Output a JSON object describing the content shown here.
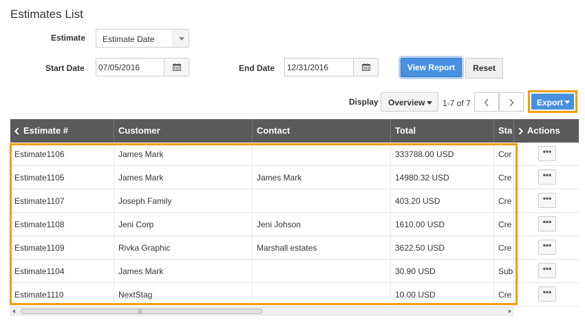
{
  "page": {
    "title": "Estimates List"
  },
  "filters": {
    "estimate_label": "Estimate",
    "estimate_value": "Estimate Date",
    "start_date_label": "Start Date",
    "start_date_value": "07/05/2016",
    "end_date_label": "End Date",
    "end_date_value": "12/31/2016",
    "view_report_label": "View Report",
    "reset_label": "Reset"
  },
  "toolbar": {
    "display_label": "Display",
    "display_value": "Overview",
    "pager_text": "1-7 of 7",
    "export_label": "Export"
  },
  "table": {
    "headers": {
      "estimate": "Estimate #",
      "customer": "Customer",
      "contact": "Contact",
      "total": "Total",
      "status": "Sta",
      "actions": "Actions"
    },
    "rows": [
      {
        "estimate": "Estimate1106",
        "customer": "James Mark",
        "contact": "",
        "total": "333788.00  USD",
        "status": "Cor",
        "action": "•••"
      },
      {
        "estimate": "Estimate1105",
        "customer": "James Mark",
        "contact": "James Mark",
        "total": "14980.32  USD",
        "status": "Cre",
        "action": "•••"
      },
      {
        "estimate": "Estimate1107",
        "customer": "Joseph Family",
        "contact": "",
        "total": "403.20  USD",
        "status": "Cre",
        "action": "•••"
      },
      {
        "estimate": "Estimate1108",
        "customer": "Jeni Corp",
        "contact": "Jeni Johson",
        "total": "1610.00  USD",
        "status": "Cre",
        "action": "•••"
      },
      {
        "estimate": "Estimate1109",
        "customer": "Rivka Graphic",
        "contact": "Marshall estates",
        "total": "3622.50  USD",
        "status": "Cre",
        "action": "•••"
      },
      {
        "estimate": "Estimate1104",
        "customer": "James Mark",
        "contact": "",
        "total": "30.90  USD",
        "status": "Sub",
        "action": "•••"
      },
      {
        "estimate": "Estimate1110",
        "customer": "NextStag",
        "contact": "",
        "total": "10.00  USD",
        "status": "Cre",
        "action": "•••"
      }
    ]
  },
  "scrollbar": {
    "grip": "|||"
  },
  "colors": {
    "accent": "#4a90e2",
    "highlight": "#f39c12",
    "header_bg": "#5a5a5a"
  },
  "icons": [
    "calendar-icon",
    "chevron-left-icon",
    "chevron-right-icon",
    "caret-down-icon"
  ]
}
